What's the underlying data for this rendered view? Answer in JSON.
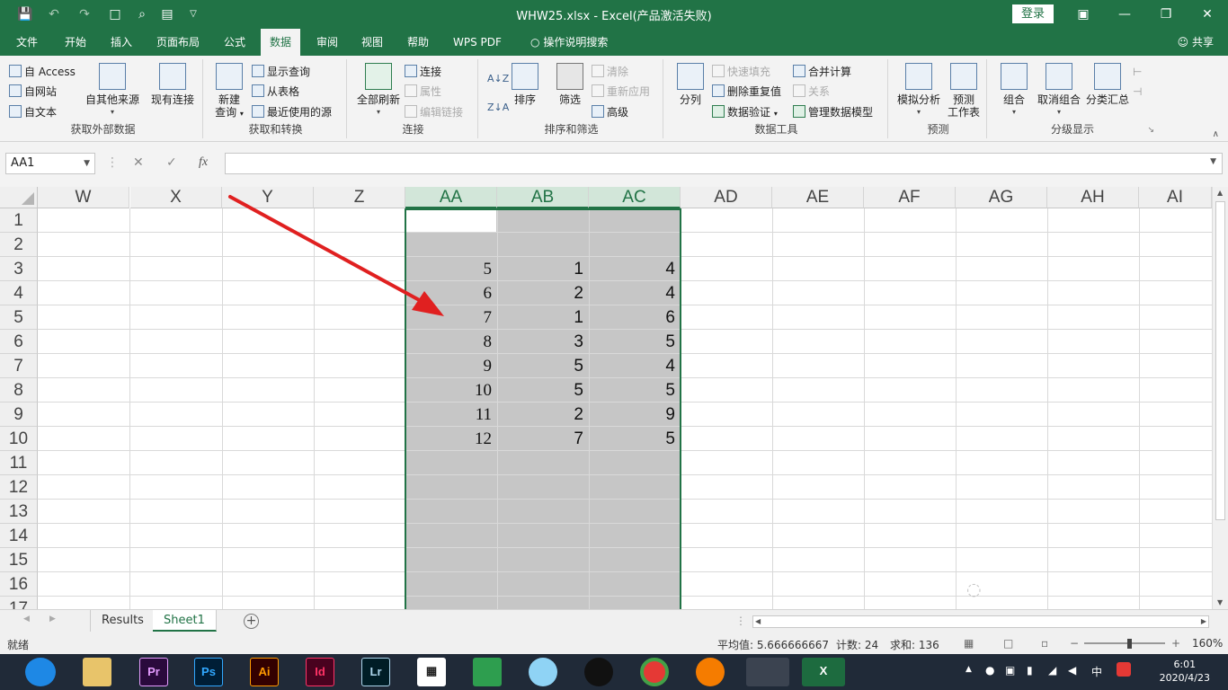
{
  "titlebar": {
    "title": "WHW25.xlsx  -  Excel(产品激活失败)",
    "login": "登录",
    "qa_icons": [
      "save-icon",
      "undo-icon",
      "redo-icon",
      "new-file-icon",
      "print-preview-icon",
      "form-icon",
      "customize-icon"
    ]
  },
  "tabs": [
    "文件",
    "开始",
    "插入",
    "页面布局",
    "公式",
    "数据",
    "审阅",
    "视图",
    "帮助",
    "WPS PDF",
    "操作说明搜索"
  ],
  "active_tab": "数据",
  "share": "共享",
  "ribbon": {
    "g1": {
      "label": "获取外部数据",
      "access": "自 Access",
      "web": "自网站",
      "text": "自文本",
      "other": "自其他来源",
      "existing": "现有连接"
    },
    "g2": {
      "label": "获取和转换",
      "newquery_1": "新建",
      "newquery_2": "查询",
      "show": "显示查询",
      "fromtable": "从表格",
      "recent": "最近使用的源"
    },
    "g3": {
      "label": "连接",
      "refresh": "全部刷新",
      "connections": "连接",
      "properties": "属性",
      "editlinks": "编辑链接"
    },
    "g4": {
      "label": "排序和筛选",
      "sort": "排序",
      "filter": "筛选",
      "clear": "清除",
      "reapply": "重新应用",
      "advanced": "高级"
    },
    "g5": {
      "label": "数据工具",
      "split": "分列",
      "flashfill": "快速填充",
      "removedup": "删除重复值",
      "validate": "数据验证",
      "consolidate": "合并计算",
      "relations": "关系",
      "datamodel": "管理数据模型"
    },
    "g6": {
      "label": "预测",
      "whatif": "模拟分析",
      "forecast_1": "预测",
      "forecast_2": "工作表"
    },
    "g7": {
      "label": "分级显示",
      "group": "组合",
      "ungroup": "取消组合",
      "subtotal": "分类汇总"
    }
  },
  "formula_bar": {
    "namebox": "AA1",
    "fx": "fx",
    "value": ""
  },
  "columns": [
    "W",
    "X",
    "Y",
    "Z",
    "AA",
    "AB",
    "AC",
    "AD",
    "AE",
    "AF",
    "AG",
    "AH",
    "AI"
  ],
  "rows": [
    "1",
    "2",
    "3",
    "4",
    "5",
    "6",
    "7",
    "8",
    "9",
    "10",
    "11",
    "12",
    "13",
    "14",
    "15",
    "16",
    "17"
  ],
  "cells": {
    "AA": [
      "",
      "",
      "5",
      "6",
      "7",
      "8",
      "9",
      "10",
      "11",
      "12"
    ],
    "AB": [
      "",
      "",
      "1",
      "2",
      "1",
      "3",
      "5",
      "5",
      "2",
      "7"
    ],
    "AC": [
      "",
      "",
      "4",
      "4",
      "6",
      "5",
      "4",
      "5",
      "9",
      "5"
    ]
  },
  "sheets": [
    "Results",
    "Sheet1"
  ],
  "active_sheet": "Sheet1",
  "status": {
    "mode": "就绪",
    "average": "平均值: 5.666666667",
    "count": "计数: 24",
    "sum": "求和: 136",
    "zoom": "160%"
  },
  "taskbar": {
    "apps": [
      "Pr",
      "Ps",
      "Ai",
      "Id",
      "Lr"
    ],
    "ime": "中",
    "time": "6:01",
    "date": "2020/4/23"
  },
  "colors": {
    "excel_green": "#217346",
    "selection": "#c6c6c6",
    "arrow": "#e02020"
  }
}
